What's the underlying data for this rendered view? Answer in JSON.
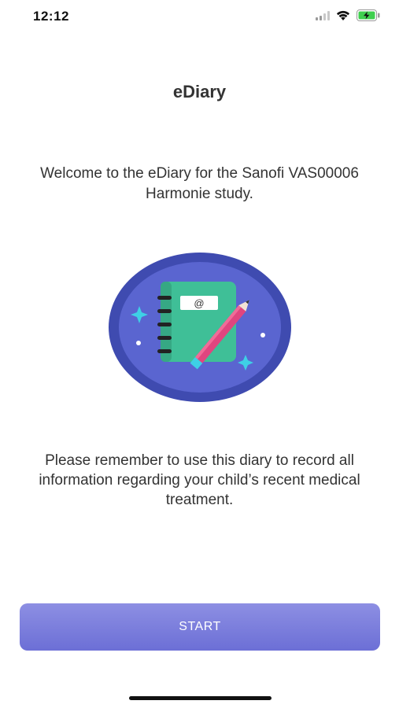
{
  "status_bar": {
    "time": "12:12",
    "icons": [
      "cellular-signal-icon",
      "wifi-icon",
      "battery-charging-icon"
    ]
  },
  "header": {
    "title": "eDiary"
  },
  "main": {
    "welcome_text": "Welcome to the eDiary for the Sanofi VAS00006 Harmonie study.",
    "illustration_icon": "diary-notebook-pencil-icon",
    "notebook_label": "@",
    "reminder_text": "Please remember to use this diary to record all information regarding your child’s recent medical treatment."
  },
  "footer": {
    "start_label": "START"
  },
  "colors": {
    "button": "#7b7de0",
    "illustration_ring": "#3f4bb0",
    "illustration_inner": "#5a65d0",
    "notebook": "#3fbf97",
    "pencil": "#e0457f"
  }
}
